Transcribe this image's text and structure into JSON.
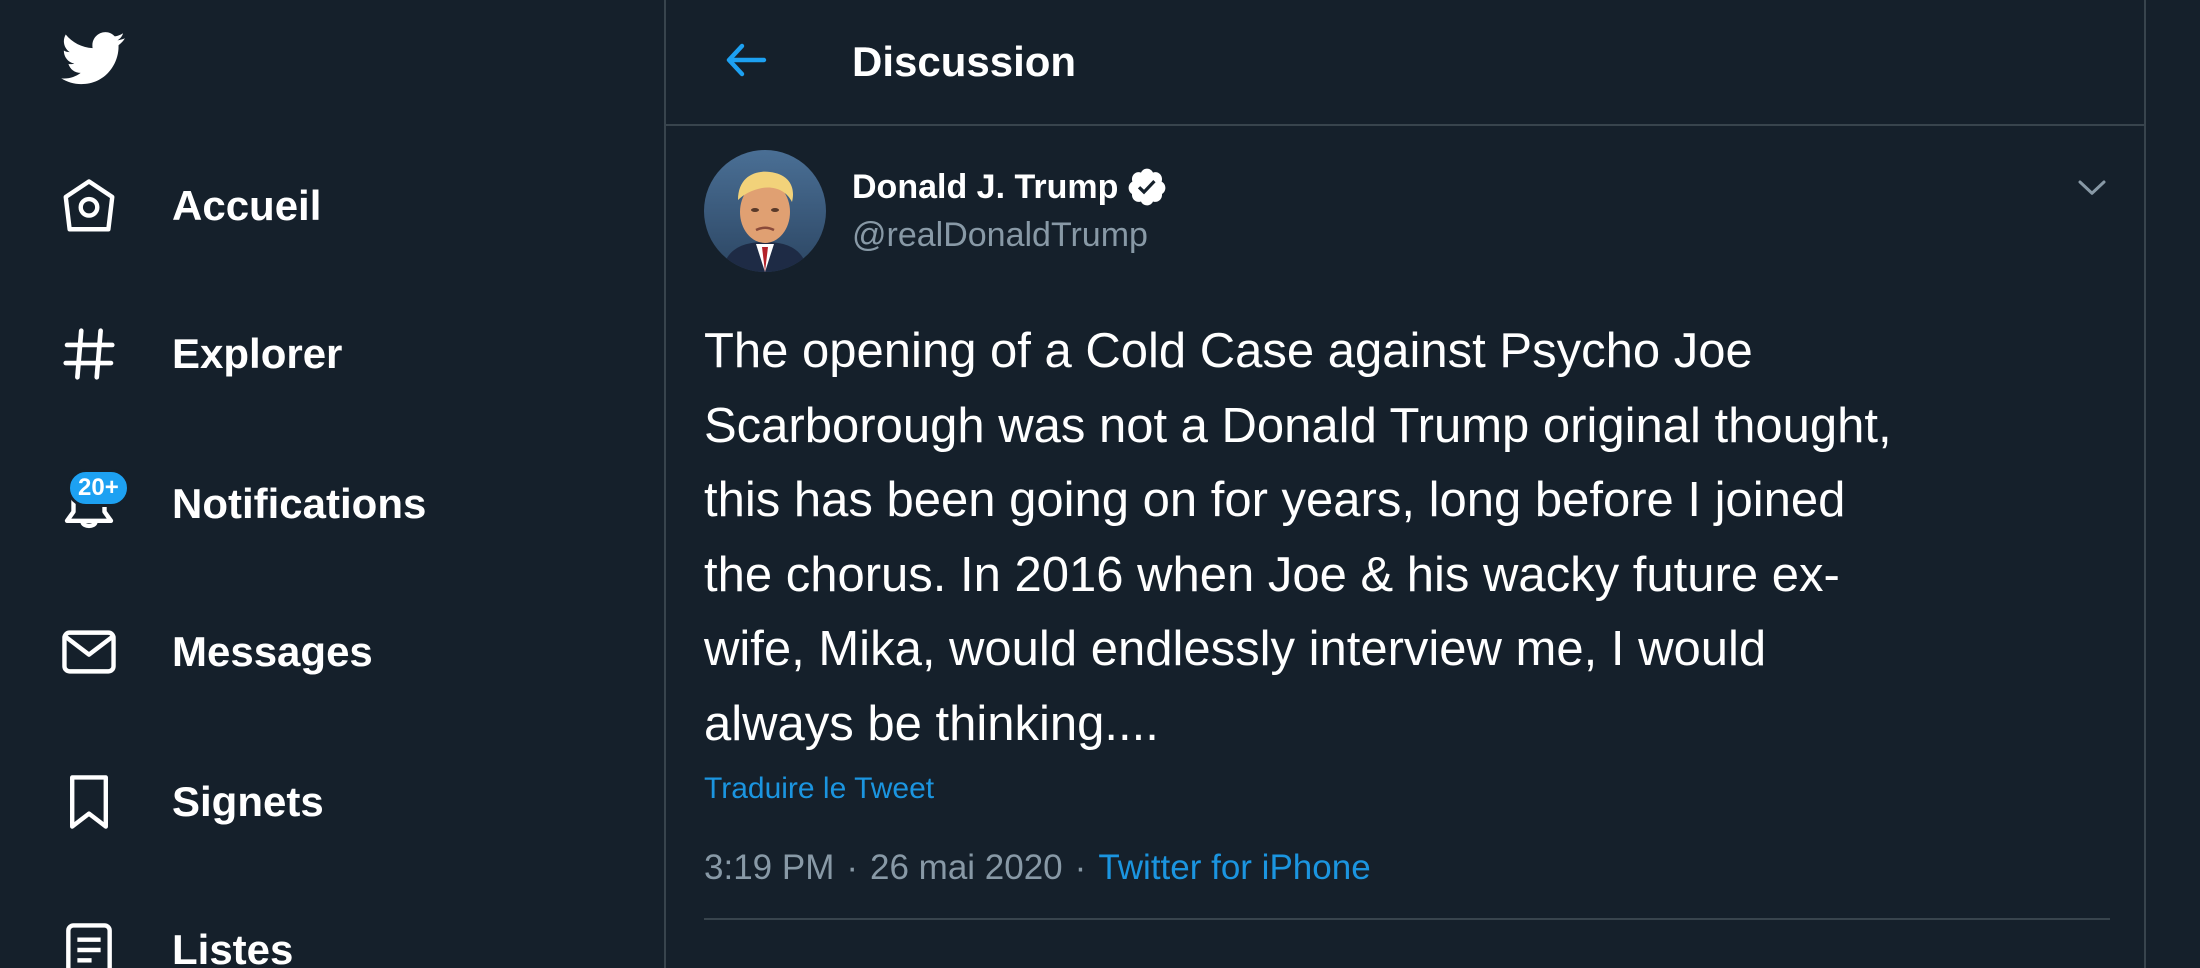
{
  "header": {
    "title": "Discussion",
    "back_icon": "arrow-left-icon"
  },
  "sidebar": {
    "logo_icon": "twitter-bird-icon",
    "items": [
      {
        "label": "Accueil",
        "icon": "home-icon"
      },
      {
        "label": "Explorer",
        "icon": "hashtag-icon"
      },
      {
        "label": "Notifications",
        "icon": "bell-icon",
        "badge": "20+"
      },
      {
        "label": "Messages",
        "icon": "envelope-icon"
      },
      {
        "label": "Signets",
        "icon": "bookmark-icon"
      },
      {
        "label": "Listes",
        "icon": "list-icon"
      }
    ]
  },
  "tweet": {
    "author": {
      "name": "Donald J. Trump",
      "handle": "@realDonaldTrump",
      "verified": true
    },
    "text": "The opening of a Cold Case against Psycho Joe\nScarborough was not a Donald Trump original thought,\nthis has been going on for years, long before I joined\nthe chorus. In 2016 when Joe & his wacky future ex-\nwife, Mika, would endlessly interview me, I would\nalways be thinking....",
    "translate_label": "Traduire le Tweet",
    "time": "3:19 PM",
    "separator": "·",
    "date": "26 mai 2020",
    "source": "Twitter for iPhone"
  },
  "colors": {
    "background": "#15202b",
    "border": "#38444d",
    "accent": "#1da1f2",
    "link": "#1b95e0",
    "secondary_text": "#8899a6"
  }
}
